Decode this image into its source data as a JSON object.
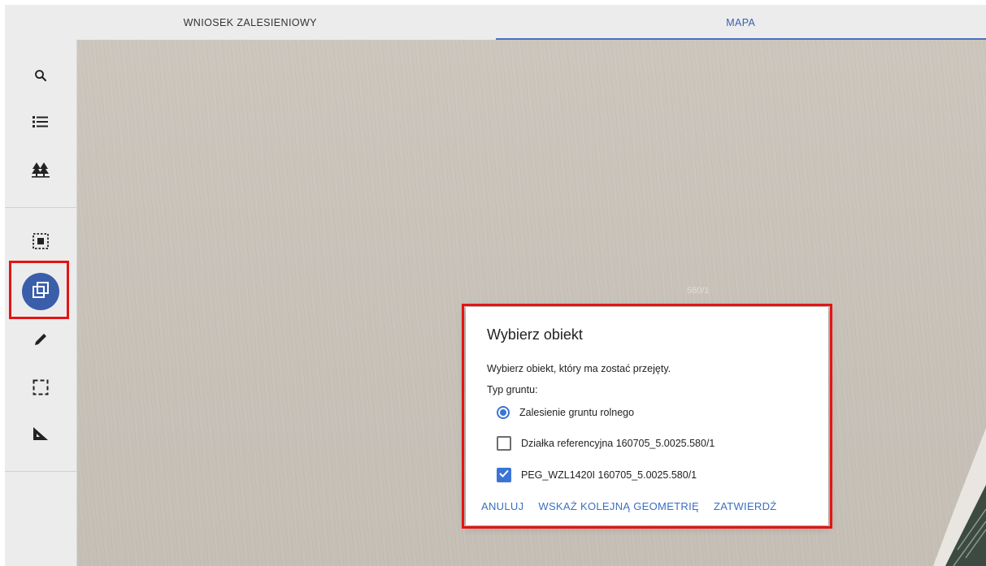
{
  "tabs": [
    {
      "label": "WNIOSEK ZALESIENIOWY",
      "active": false
    },
    {
      "label": "MAPA",
      "active": true
    }
  ],
  "sidebar": {
    "tools": [
      {
        "icon": "search-icon"
      },
      {
        "icon": "list-icon"
      },
      {
        "icon": "trees-icon"
      },
      {
        "icon": "select-area-icon"
      },
      {
        "icon": "copy-geometry-icon",
        "active": true
      },
      {
        "icon": "pencil-icon"
      },
      {
        "icon": "rectangle-select-icon"
      },
      {
        "icon": "ruler-triangle-icon"
      }
    ]
  },
  "map": {
    "parcel_label": "580/1"
  },
  "dialog": {
    "title": "Wybierz obiekt",
    "description": "Wybierz obiekt, który ma zostać przejęty.",
    "type_label": "Typ gruntu:",
    "options": [
      {
        "label": "Zalesienie gruntu rolnego",
        "kind": "radio",
        "selected": true
      },
      {
        "label": "Działka referencyjna 160705_5.0025.580/1",
        "kind": "checkbox",
        "checked": false
      },
      {
        "label": "PEG_WZL1420I 160705_5.0025.580/1",
        "kind": "checkbox",
        "checked": true
      }
    ],
    "actions": {
      "cancel": "ANULUJ",
      "next_geometry": "WSKAŻ KOLEJNĄ GEOMETRIĘ",
      "confirm": "ZATWIERDŹ"
    }
  },
  "colors": {
    "accent": "#3b5eab",
    "link": "#3b6fc0",
    "highlight": "#e41414"
  }
}
